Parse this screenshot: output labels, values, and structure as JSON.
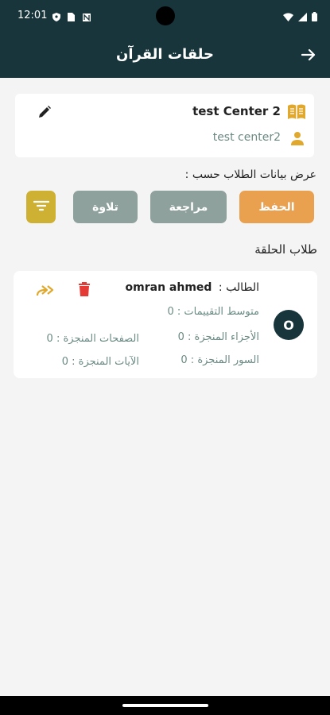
{
  "status_bar": {
    "time": "12:01",
    "icons": [
      "shield-icon",
      "sim-icon",
      "notification-icon",
      "wifi-icon",
      "signal-icon",
      "battery-icon"
    ]
  },
  "app_bar": {
    "title": "حلقات القرآن",
    "back_icon": "arrow-right-icon"
  },
  "center": {
    "name": "test Center 2",
    "subtitle": "test center2",
    "icons": [
      "book-icon",
      "person-icon",
      "edit-icon"
    ]
  },
  "filter": {
    "label": "عرض بيانات الطلاب حسب :",
    "options": [
      "الحفظ",
      "مراجعة",
      "تلاوة"
    ],
    "selected": "الحفظ",
    "filter_icon": "filter-icon"
  },
  "students_section": {
    "title": "طلاب الحلقة"
  },
  "students": [
    {
      "initial": "O",
      "label": "الطالب :",
      "name": "omran  ahmed",
      "avg_rating": "متوسط التقييمات : 0",
      "juz_done": "الأجزاء المنجزة : 0",
      "pages_done": "الصفحات المنجزة : 0",
      "surah_done": "السور المنجزة : 0",
      "ayat_done": "الآيات المنجزة : 0"
    }
  ],
  "colors": {
    "primary": "#17353b",
    "accent_orange": "#e9a04f",
    "chip_grey": "#8ea19d",
    "gold": "#ceb132",
    "delete_red": "#e53935"
  }
}
